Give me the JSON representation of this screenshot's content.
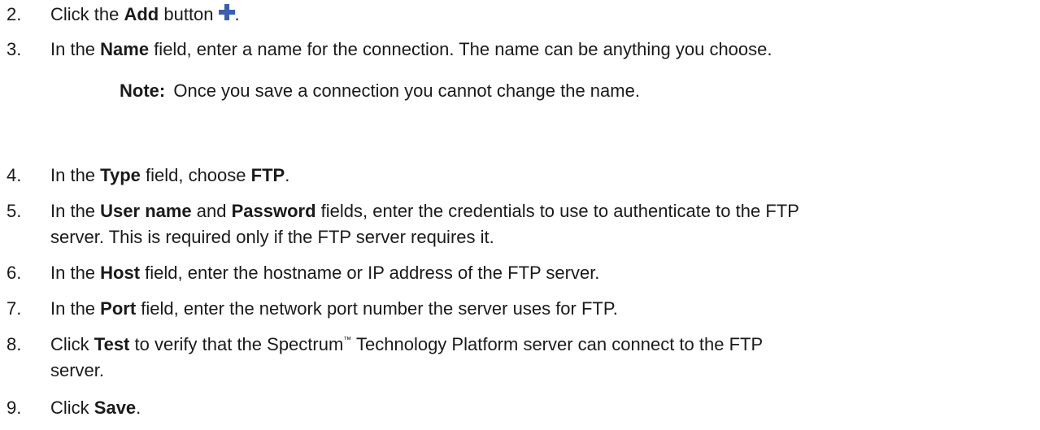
{
  "steps": [
    {
      "number": "2.",
      "parts": [
        "Click the ",
        "Add",
        " button",
        "."
      ]
    },
    {
      "number": "3.",
      "parts": [
        "In the ",
        "Name",
        " field, enter a name for the connection. The name can be anything you choose."
      ]
    },
    {
      "number": "4.",
      "parts": [
        "In the ",
        "Type",
        " field, choose ",
        "FTP",
        "."
      ]
    },
    {
      "number": "5.",
      "parts": [
        "In the ",
        "User name",
        " and ",
        "Password",
        " fields, enter the credentials to use to authenticate to the FTP",
        "server. This is required only if the FTP server requires it."
      ]
    },
    {
      "number": "6.",
      "parts": [
        "In the ",
        "Host",
        " field, enter the hostname or IP address of the FTP server."
      ]
    },
    {
      "number": "7.",
      "parts": [
        "In the ",
        "Port",
        " field, enter the network port number the server uses for FTP."
      ]
    },
    {
      "number": "8.",
      "parts": [
        "Click ",
        "Test",
        " to verify that the Spectrum",
        "™",
        " Technology Platform server can connect to the FTP",
        "server."
      ]
    },
    {
      "number": "9.",
      "parts": [
        "Click ",
        "Save",
        "."
      ]
    }
  ],
  "note": {
    "label": "Note:",
    "text": "Once you save a connection you cannot change the name."
  },
  "icons": {
    "add_icon": "plus-icon",
    "add_icon_color": "#3b5fb0"
  }
}
